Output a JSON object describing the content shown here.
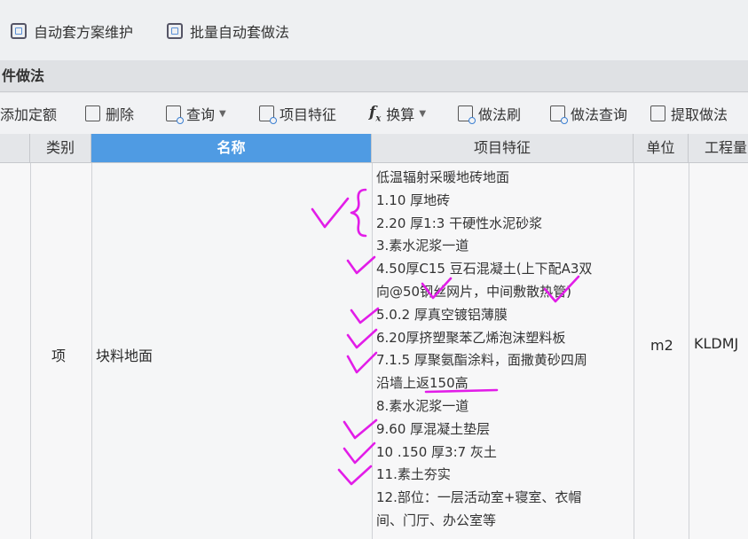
{
  "topbar": {
    "buttons": [
      {
        "label": "自动套方案维护",
        "icon": "scheme-icon"
      },
      {
        "label": "批量自动套做法",
        "icon": "batch-icon"
      }
    ]
  },
  "section": {
    "title": "件做法"
  },
  "toolbar": {
    "items": [
      {
        "label": "添加定额",
        "icon": ""
      },
      {
        "label": "删除",
        "icon": "trash-icon"
      },
      {
        "label": "查询",
        "icon": "query-icon",
        "has_dropdown": true
      },
      {
        "label": "项目特征",
        "icon": "feature-icon"
      },
      {
        "label": "换算",
        "icon": "fx-icon",
        "has_dropdown": true
      },
      {
        "label": "做法刷",
        "icon": "brush-icon"
      },
      {
        "label": "做法查询",
        "icon": "method-query-icon"
      },
      {
        "label": "提取做法",
        "icon": "extract-icon"
      }
    ]
  },
  "table": {
    "columns": [
      "类别",
      "名称",
      "项目特征",
      "单位",
      "工程量"
    ],
    "selected_column": "名称",
    "row": {
      "category": "项",
      "name": "块料地面",
      "unit": "m2",
      "quantity_expr": "KLDMJ",
      "features": [
        "低温辐射采暖地砖地面",
        "1.10 厚地砖",
        "2.20 厚1:3 干硬性水泥砂浆",
        "3.素水泥浆一道",
        "4.50厚C15 豆石混凝土(上下配A3双",
        "向@50钢丝网片，中间敷散热管)",
        "5.0.2 厚真空镀铝薄膜",
        "6.20厚挤塑聚苯乙烯泡沫塑料板",
        "7.1.5 厚聚氨酯涂料，面撒黄砂四周",
        "沿墙上返150高",
        "8.素水泥浆一道",
        "9.60 厚混凝土垫层",
        "10 .150 厚3:7 灰土",
        "11.素土夯实",
        "12.部位：一层活动室+寝室、衣帽",
        "间、门厅、办公室等"
      ]
    }
  },
  "colors": {
    "header_selected": "#4f9be3",
    "annotation": "#e21de8"
  }
}
